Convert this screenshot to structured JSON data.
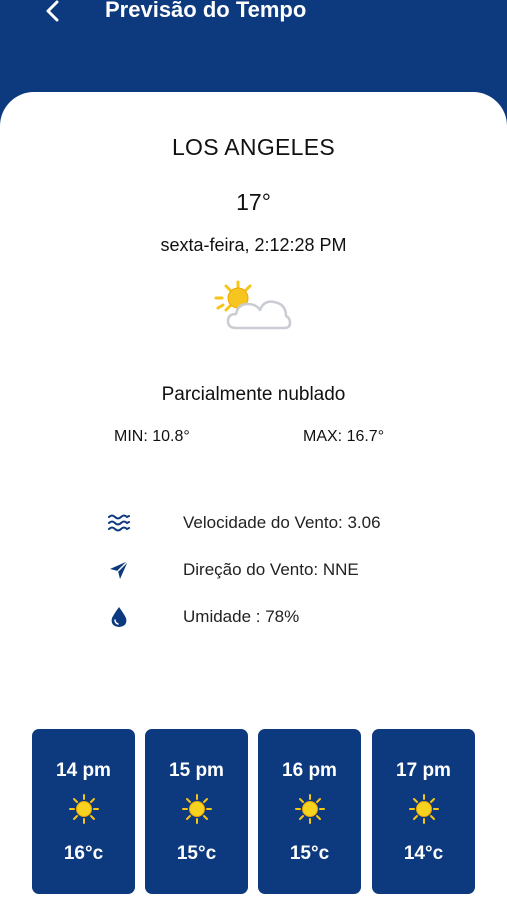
{
  "header": {
    "title": "Previsão do Tempo",
    "back_icon": "chevron-left-icon"
  },
  "current": {
    "city": "LOS ANGELES",
    "temperature": "17°",
    "datetime": "sexta-feira, 2:12:28 PM",
    "condition_icon": "partly-cloudy-icon",
    "condition": "Parcialmente nublado",
    "min": "MIN: 10.8°",
    "max": "MAX: 16.7°"
  },
  "details": {
    "wind_speed": {
      "icon": "waves-icon",
      "label": "Velocidade do Vento: 3.06"
    },
    "wind_direction": {
      "icon": "navigation-arrow-icon",
      "label": "Direção do Vento: NNE"
    },
    "humidity": {
      "icon": "water-drop-icon",
      "label": "Umidade : 78%"
    }
  },
  "forecast": [
    {
      "hour": "14 pm",
      "icon": "sun-icon",
      "temp": "16°c"
    },
    {
      "hour": "15 pm",
      "icon": "sun-icon",
      "temp": "15°c"
    },
    {
      "hour": "16 pm",
      "icon": "sun-icon",
      "temp": "15°c"
    },
    {
      "hour": "17 pm",
      "icon": "sun-icon",
      "temp": "14°c"
    }
  ],
  "colors": {
    "primary": "#0d3a7e",
    "background": "#ffffff",
    "sun": "#f5c518"
  }
}
